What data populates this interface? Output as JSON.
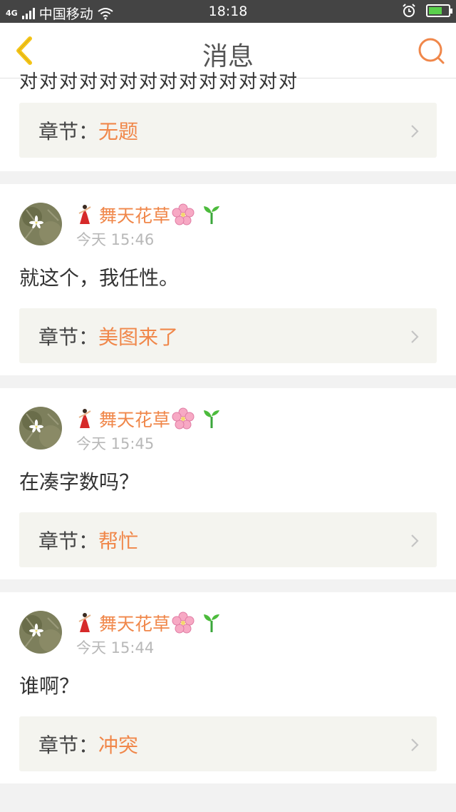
{
  "status_bar": {
    "network": "4G",
    "carrier": "中国移动",
    "time": "18:18",
    "battery_level": 0.7
  },
  "nav": {
    "title": "消息"
  },
  "top_card": {
    "cut_text": "对对对对对对对对对对对对对对",
    "chapter_label": "章节：",
    "chapter_name": "无题"
  },
  "messages": [
    {
      "user": "舞天花草",
      "time": "今天 15:46",
      "text": "就这个，我任性。",
      "chapter_label": "章节：",
      "chapter_name": "美图来了"
    },
    {
      "user": "舞天花草",
      "time": "今天 15:45",
      "text": "在凑字数吗？",
      "chapter_label": "章节：",
      "chapter_name": "帮忙"
    },
    {
      "user": "舞天花草",
      "time": "今天 15:44",
      "text": "谁啊？",
      "chapter_label": "章节：",
      "chapter_name": "冲突"
    }
  ],
  "colors": {
    "accent": "#f0874a",
    "back_arrow": "#f5c518",
    "status_bg": "#444444"
  },
  "icons": [
    "back-arrow-icon",
    "search-icon",
    "chevron-right-icon",
    "dancer-emoji-icon",
    "cherry-blossom-icon",
    "seedling-icon",
    "alarm-icon",
    "battery-icon",
    "wifi-icon"
  ]
}
